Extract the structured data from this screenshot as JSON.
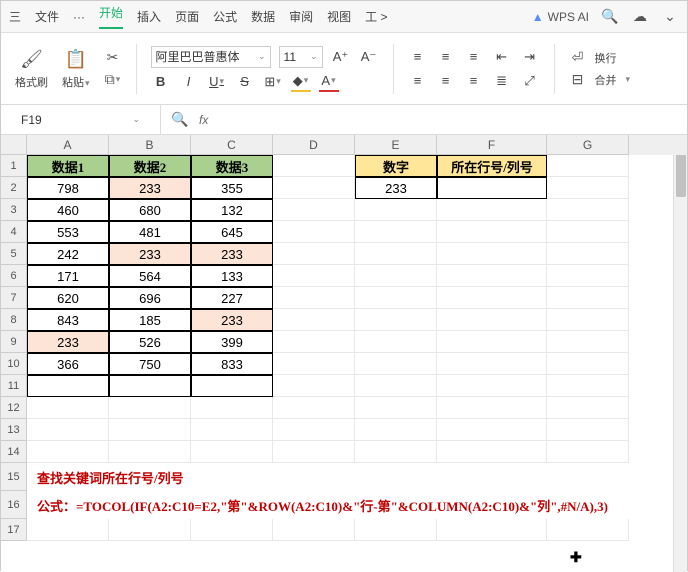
{
  "menu": {
    "hamburger": "三",
    "file": "文件",
    "more": "···",
    "start": "开始",
    "insert": "插入",
    "page": "页面",
    "formula": "公式",
    "data": "数据",
    "review": "审阅",
    "view": "视图",
    "tools": "工 >"
  },
  "ai": {
    "logo": "▲",
    "label": "WPS AI"
  },
  "ribbon": {
    "format_brush": "格式刷",
    "paste": "粘贴",
    "font_name": "阿里巴巴普惠体",
    "font_size": "11",
    "wrap": "换行",
    "merge": "合并"
  },
  "namebox": "F19",
  "headers": {
    "A": "A",
    "B": "B",
    "C": "C",
    "D": "D",
    "E": "E",
    "F": "F",
    "G": "G"
  },
  "th": {
    "d1": "数据1",
    "d2": "数据2",
    "d3": "数据3",
    "num": "数字",
    "loc": "所在行号/列号"
  },
  "data": {
    "r2": {
      "a": "798",
      "b": "233",
      "c": "355",
      "e": "233",
      "f": ""
    },
    "r3": {
      "a": "460",
      "b": "680",
      "c": "132"
    },
    "r4": {
      "a": "553",
      "b": "481",
      "c": "645"
    },
    "r5": {
      "a": "242",
      "b": "233",
      "c": "233"
    },
    "r6": {
      "a": "171",
      "b": "564",
      "c": "133"
    },
    "r7": {
      "a": "620",
      "b": "696",
      "c": "227"
    },
    "r8": {
      "a": "843",
      "b": "185",
      "c": "233"
    },
    "r9": {
      "a": "233",
      "b": "526",
      "c": "399"
    },
    "r10": {
      "a": "366",
      "b": "750",
      "c": "833"
    }
  },
  "note": {
    "l1": "查找关键词所在行号/列号",
    "l2": "公式：=TOCOL(IF(A2:C10=E2,\"第\"&ROW(A2:C10)&\"行-第\"&COLUMN(A2:C10)&\"列\",#N/A),3)"
  },
  "rows": [
    "1",
    "2",
    "3",
    "4",
    "5",
    "6",
    "7",
    "8",
    "9",
    "10",
    "11",
    "12",
    "13",
    "14",
    "15",
    "16",
    "17"
  ]
}
